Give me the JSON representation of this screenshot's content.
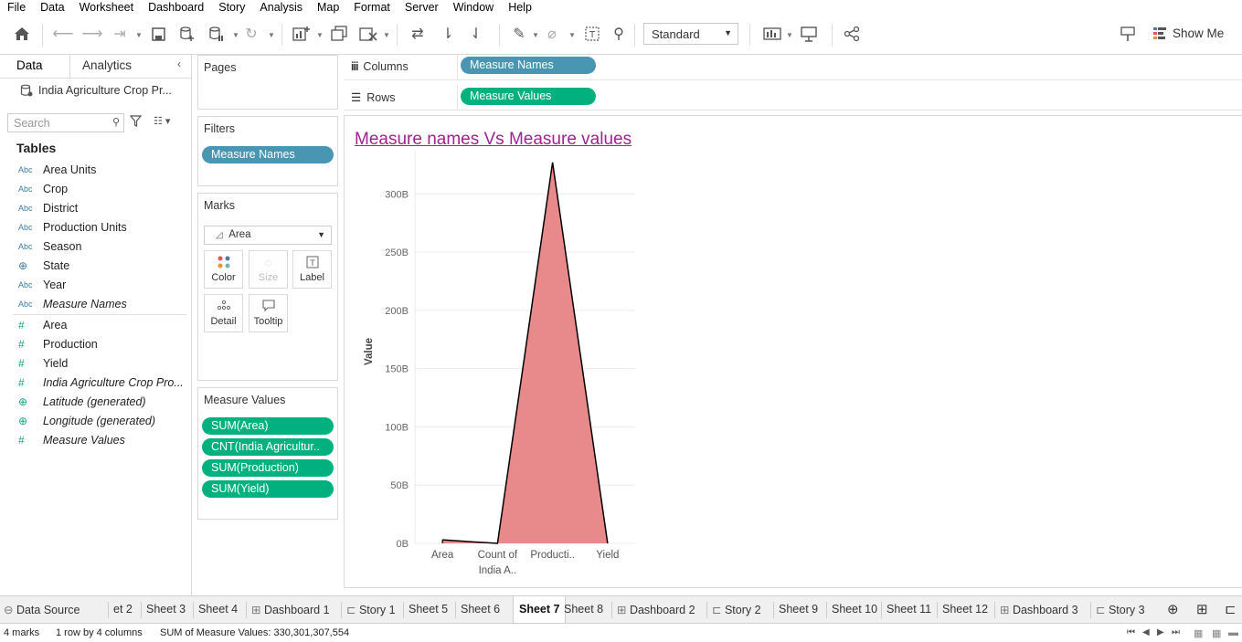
{
  "menu": [
    "File",
    "Data",
    "Worksheet",
    "Dashboard",
    "Story",
    "Analysis",
    "Map",
    "Format",
    "Server",
    "Window",
    "Help"
  ],
  "toolbar": {
    "fit": "Standard",
    "show_me": "Show Me",
    "icons": [
      "home-icon",
      "undo-icon",
      "redo-icon",
      "replay-icon",
      "save-icon",
      "new-data-source-icon",
      "pause-updates-icon",
      "refresh-icon",
      "new-worksheet-icon",
      "duplicate-icon",
      "clear-sheet-icon",
      "swap-icon",
      "sort-ascending-icon",
      "sort-descending-icon",
      "highlight-icon",
      "group-icon",
      "labels-icon",
      "fix-axes-icon",
      "show-cards-icon",
      "presentation-icon",
      "share-icon",
      "tooltip-icon"
    ]
  },
  "left_pane": {
    "tab_data": "Data",
    "tab_analytics": "Analytics",
    "data_source": "India Agriculture Crop Pr...",
    "search_placeholder": "Search",
    "tables_header": "Tables",
    "dimensions": [
      {
        "type": "Abc",
        "label": "Area Units"
      },
      {
        "type": "Abc",
        "label": "Crop"
      },
      {
        "type": "Abc",
        "label": "District"
      },
      {
        "type": "Abc",
        "label": "Production Units"
      },
      {
        "type": "Abc",
        "label": "Season"
      },
      {
        "type": "geo",
        "label": "State"
      },
      {
        "type": "Abc",
        "label": "Year"
      },
      {
        "type": "Abc",
        "label": "Measure Names"
      }
    ],
    "measures": [
      {
        "type": "#",
        "label": "Area"
      },
      {
        "type": "#",
        "label": "Production"
      },
      {
        "type": "#",
        "label": "Yield"
      },
      {
        "type": "#",
        "label": "India Agriculture Crop Pro..."
      },
      {
        "type": "geo",
        "label": "Latitude (generated)"
      },
      {
        "type": "geo",
        "label": "Longitude (generated)"
      },
      {
        "type": "#",
        "label": "Measure Values"
      }
    ]
  },
  "cards": {
    "pages_title": "Pages",
    "filters_title": "Filters",
    "filter_pill": "Measure Names",
    "marks_title": "Marks",
    "mark_type": "Area",
    "mark_buttons": [
      "Color",
      "Size",
      "Label",
      "Detail",
      "Tooltip"
    ],
    "measure_values_title": "Measure Values",
    "measure_values": [
      "SUM(Area)",
      "CNT(India Agricultur..",
      "SUM(Production)",
      "SUM(Yield)"
    ]
  },
  "shelves": {
    "columns_label": "Columns",
    "columns_pill": "Measure Names",
    "rows_label": "Rows",
    "rows_pill": "Measure Values"
  },
  "viz": {
    "title": "Measure names Vs Measure values"
  },
  "chart_data": {
    "type": "area",
    "categories": [
      "Area",
      "Count of India A..",
      "Producti..",
      "Yield"
    ],
    "category_lines": [
      [
        "Area"
      ],
      [
        "Count of",
        "India A.."
      ],
      [
        "Producti.."
      ],
      [
        "Yield"
      ]
    ],
    "values": [
      3000000000,
      0,
      327000000000,
      0
    ],
    "ylabel": "Value",
    "yticks": [
      0,
      50,
      100,
      150,
      200,
      250,
      300
    ],
    "ytick_labels": [
      "0B",
      "50B",
      "100B",
      "150B",
      "200B",
      "250B",
      "300B"
    ],
    "ylim": [
      0,
      330
    ],
    "unit": "B",
    "fill_color": "#e8898b",
    "stroke_color": "#000000",
    "grid": true
  },
  "sheet_tabs": [
    "Data Source",
    "et 2",
    "Sheet 3",
    "Sheet 4",
    "Dashboard 1",
    "Story 1",
    "Sheet 5",
    "Sheet 6",
    "Sheet 7",
    "Sheet 8",
    "Dashboard 2",
    "Story 2",
    "Sheet 9",
    "Sheet 10",
    "Sheet 11",
    "Sheet 12",
    "Dashboard 3",
    "Story 3"
  ],
  "active_sheet": "Sheet 7",
  "status": {
    "marks": "4 marks",
    "dims": "1 row by 4 columns",
    "sum": "SUM of Measure Values: 330,301,307,554"
  }
}
